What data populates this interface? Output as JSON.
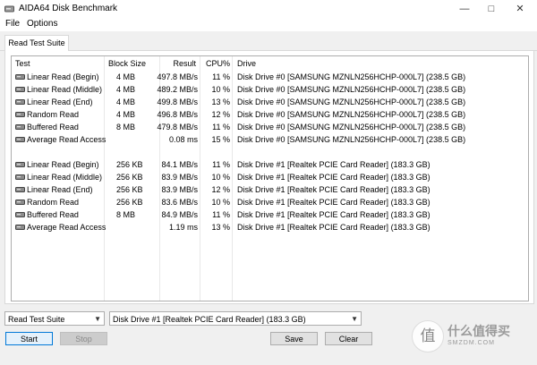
{
  "window": {
    "title": "AIDA64 Disk Benchmark"
  },
  "menu": [
    "File",
    "Options"
  ],
  "tabs": [
    "Read Test Suite"
  ],
  "table": {
    "headers": [
      "Test",
      "Block Size",
      "Result",
      "CPU%",
      "Drive"
    ],
    "group1": [
      [
        "Linear Read (Begin)",
        "4 MB",
        "497.8 MB/s",
        "11 %",
        "Disk Drive #0  [SAMSUNG MZNLN256HCHP-000L7]  (238.5 GB)"
      ],
      [
        "Linear Read (Middle)",
        "4 MB",
        "489.2 MB/s",
        "10 %",
        "Disk Drive #0  [SAMSUNG MZNLN256HCHP-000L7]  (238.5 GB)"
      ],
      [
        "Linear Read (End)",
        "4 MB",
        "499.8 MB/s",
        "13 %",
        "Disk Drive #0  [SAMSUNG MZNLN256HCHP-000L7]  (238.5 GB)"
      ],
      [
        "Random Read",
        "4 MB",
        "496.8 MB/s",
        "12 %",
        "Disk Drive #0  [SAMSUNG MZNLN256HCHP-000L7]  (238.5 GB)"
      ],
      [
        "Buffered Read",
        "8 MB",
        "479.8 MB/s",
        "11 %",
        "Disk Drive #0  [SAMSUNG MZNLN256HCHP-000L7]  (238.5 GB)"
      ],
      [
        "Average Read Access",
        "",
        "0.08 ms",
        "15 %",
        "Disk Drive #0  [SAMSUNG MZNLN256HCHP-000L7]  (238.5 GB)"
      ]
    ],
    "group2": [
      [
        "Linear Read (Begin)",
        "256 KB",
        "84.1 MB/s",
        "11 %",
        "Disk Drive #1  [Realtek PCIE Card Reader]  (183.3 GB)"
      ],
      [
        "Linear Read (Middle)",
        "256 KB",
        "83.9 MB/s",
        "10 %",
        "Disk Drive #1  [Realtek PCIE Card Reader]  (183.3 GB)"
      ],
      [
        "Linear Read (End)",
        "256 KB",
        "83.9 MB/s",
        "12 %",
        "Disk Drive #1  [Realtek PCIE Card Reader]  (183.3 GB)"
      ],
      [
        "Random Read",
        "256 KB",
        "83.6 MB/s",
        "10 %",
        "Disk Drive #1  [Realtek PCIE Card Reader]  (183.3 GB)"
      ],
      [
        "Buffered Read",
        "8 MB",
        "84.9 MB/s",
        "11 %",
        "Disk Drive #1  [Realtek PCIE Card Reader]  (183.3 GB)"
      ],
      [
        "Average Read Access",
        "",
        "1.19 ms",
        "13 %",
        "Disk Drive #1  [Realtek PCIE Card Reader]  (183.3 GB)"
      ]
    ]
  },
  "controls": {
    "test_select": "Read Test Suite",
    "drive_select": "Disk Drive #1  [Realtek PCIE Card Reader]  (183.3 GB)",
    "start": "Start",
    "stop": "Stop",
    "save": "Save",
    "clear": "Clear"
  },
  "watermark": {
    "text": "什么值得买",
    "sub": "SMZDM.COM",
    "glyph": "值"
  }
}
